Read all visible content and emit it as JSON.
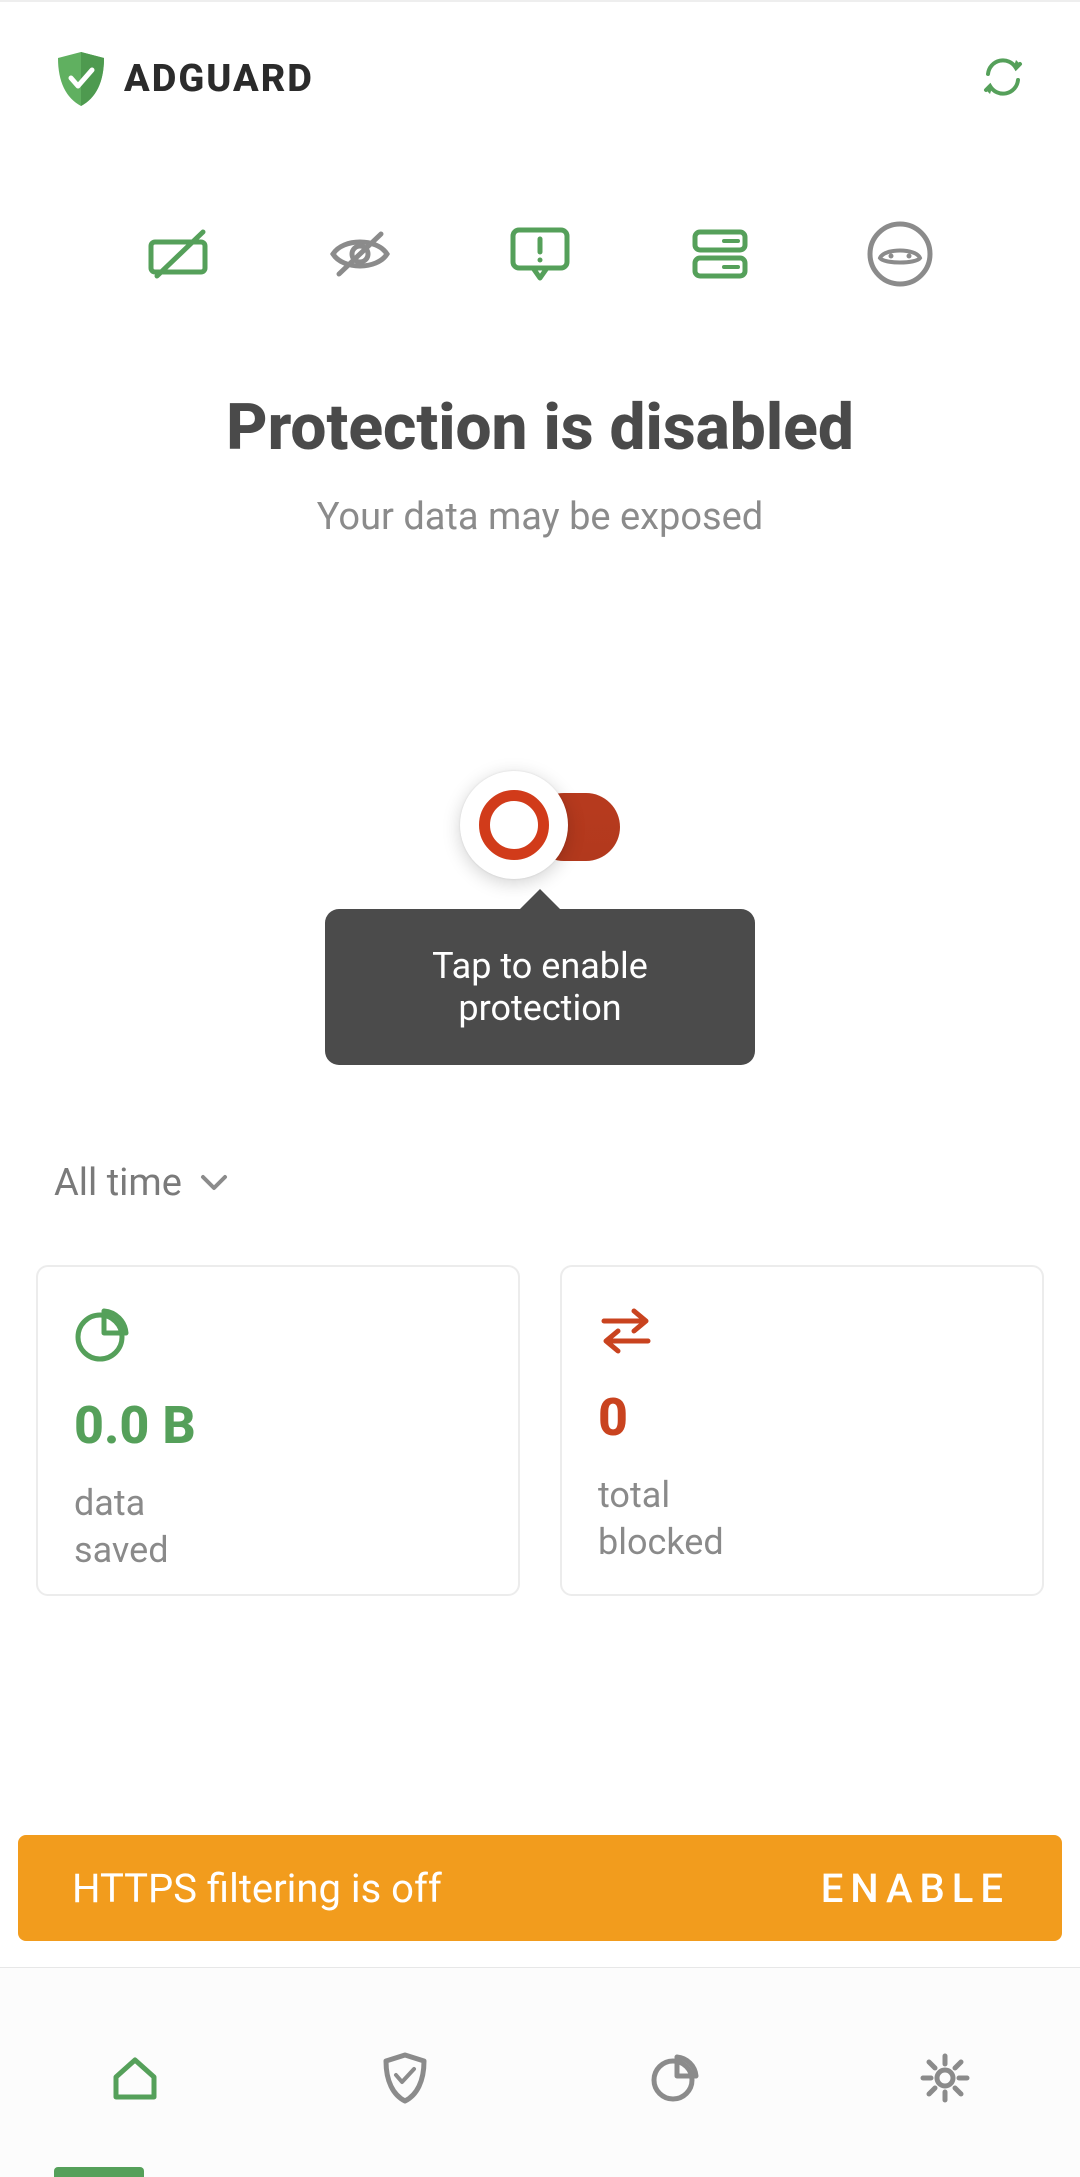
{
  "header": {
    "brand": "ADGUARD"
  },
  "status": {
    "title": "Protection is disabled",
    "subtitle": "Your data may be exposed"
  },
  "tooltip": {
    "text": "Tap to enable protection"
  },
  "filter": {
    "label": "All time"
  },
  "cards": {
    "saved": {
      "value": "0.0 B",
      "label": "data\nsaved"
    },
    "blocked": {
      "value": "0",
      "label": "total\nblocked"
    }
  },
  "banner": {
    "text": "HTTPS filtering is off",
    "action": "ENABLE"
  },
  "colors": {
    "green": "#55a05a",
    "red": "#c9431f",
    "orange": "#f29c1d",
    "gray": "#8b8b8b"
  },
  "icons": {
    "features": [
      "battery-slash-icon",
      "eye-slash-icon",
      "chat-alert-icon",
      "dns-icon",
      "private-browsing-icon"
    ]
  }
}
